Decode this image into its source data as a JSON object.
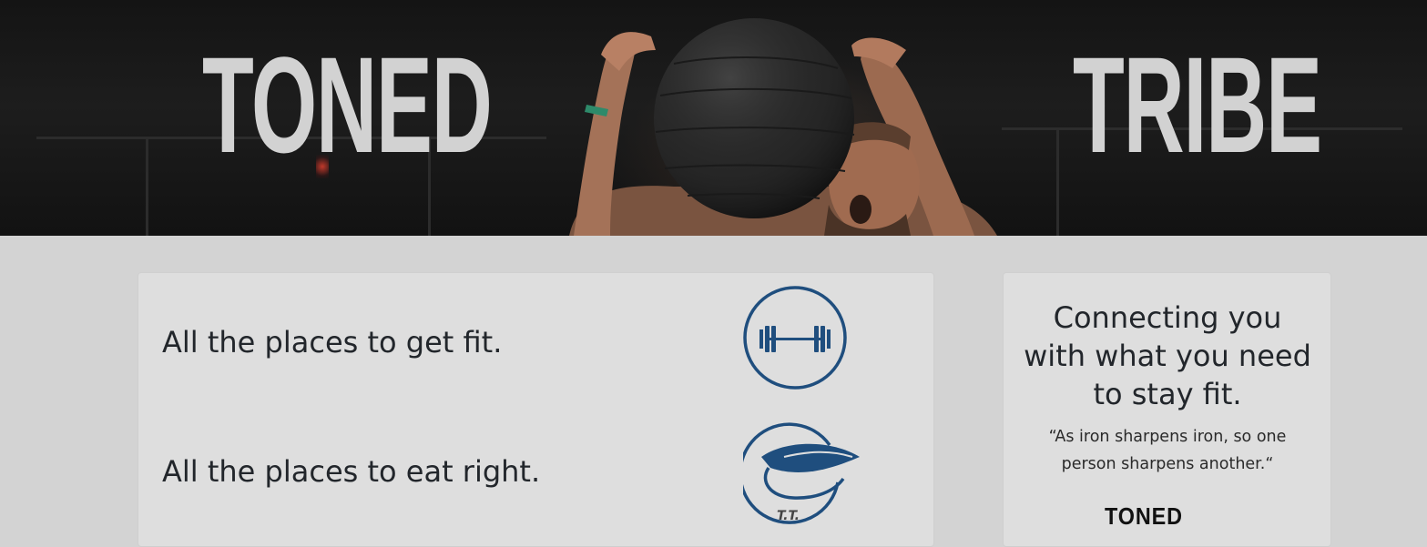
{
  "hero": {
    "word_left": "TONED",
    "word_right": "TRIBE"
  },
  "main_card": {
    "features": [
      {
        "text": "All the places to get fit.",
        "icon": "barbell-icon"
      },
      {
        "text": "All the places to eat right.",
        "icon": "leaf-icon",
        "icon_caption": "T.T."
      }
    ]
  },
  "side_card": {
    "tagline": "Connecting you with what you need to stay fit.",
    "quote": "“As iron sharpens iron, so one person sharpens another.“",
    "logo_text": "TONED"
  },
  "colors": {
    "icon_blue": "#1f4e7e",
    "background": "#d3d3d3",
    "card": "#dedede",
    "hero_text": "#d2d2d2"
  }
}
